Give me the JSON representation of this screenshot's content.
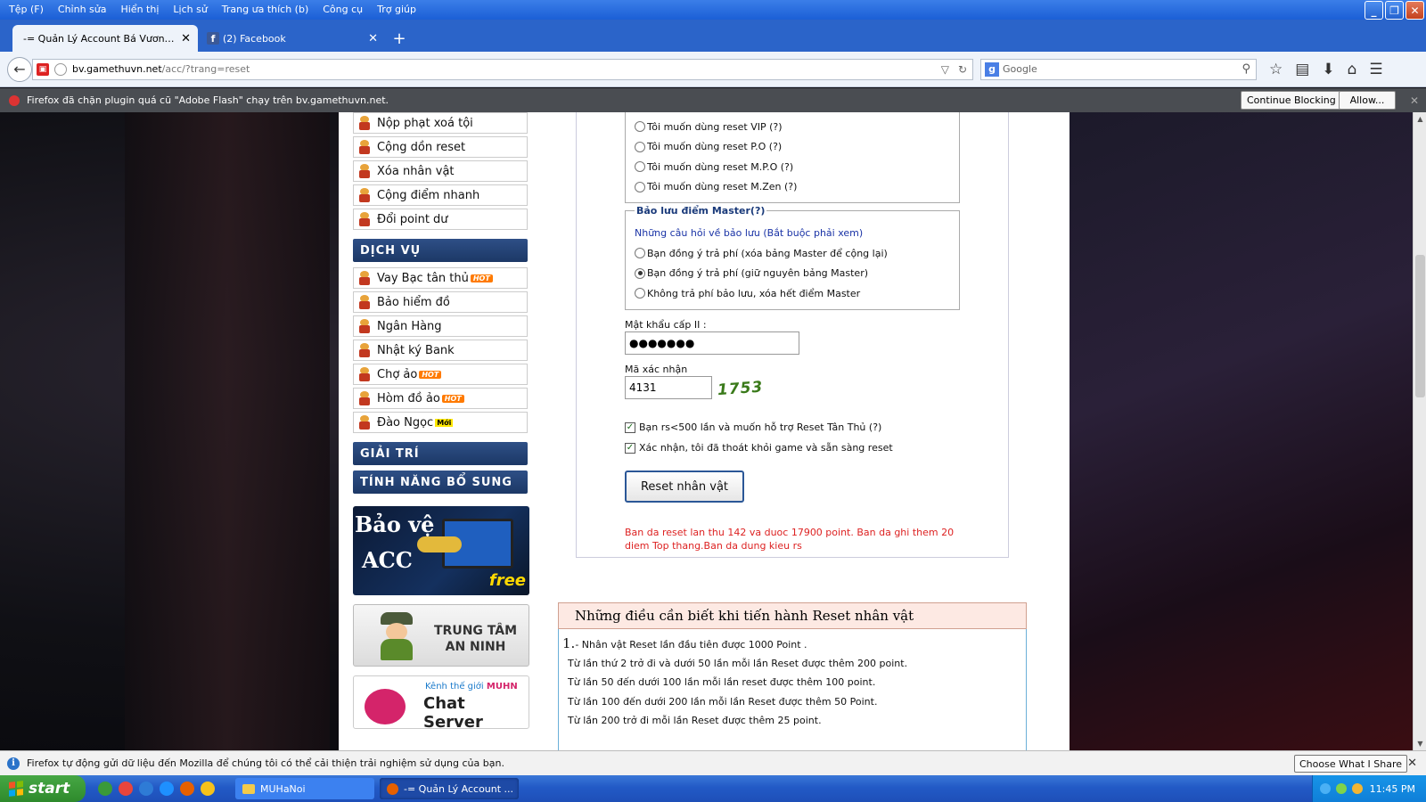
{
  "menubar": [
    "Tệp (F)",
    "Chỉnh sửa",
    "Hiển thị",
    "Lịch sử",
    "Trang ưa thích (b)",
    "Công cụ",
    "Trợ giúp"
  ],
  "tabs": [
    {
      "label": "-= Quản Lý Account Bá Vương =- ...",
      "active": true
    },
    {
      "label": "(2) Facebook",
      "active": false
    }
  ],
  "urlbar": {
    "host": "bv.gamethuvn.net",
    "path": "/acc/?trang=reset"
  },
  "searchbar": {
    "placeholder": "Google"
  },
  "plugin_bar": {
    "message": "Firefox đã chặn plugin quá cũ \"Adobe Flash\" chạy trên bv.gamethuvn.net.",
    "continue_label": "Continue Blocking",
    "allow_label": "Allow..."
  },
  "sidebar": {
    "items_top": [
      "Nộp phạt xoá tội",
      "Cộng dồn reset",
      "Xóa nhân vật",
      "Cộng điểm nhanh",
      "Đổi point dư"
    ],
    "dichvu_header": "DỊCH VỤ",
    "dichvu_items": [
      "Vay Bạc tân thủ",
      "Bảo hiểm đồ",
      "Ngân Hàng",
      "Nhật ký Bank",
      "Chợ ảo",
      "Hòm đồ ảo",
      "Đào Ngọc"
    ],
    "hot_badge": "HOT",
    "moi_badge": "Mới",
    "giaitri_header": "GIẢI TRÍ",
    "tinhnang_header": "TÍNH NĂNG BỔ SUNG",
    "banner_acc": {
      "line1": "Bảo vệ",
      "line2": "ACC",
      "tag": "free"
    },
    "banner_security": {
      "line1": "TRUNG TÂM",
      "line2": "AN NINH"
    },
    "banner_chat": {
      "kenh": "Kênh thế giới",
      "brand": "MUHN",
      "title": "Chat Server"
    }
  },
  "form": {
    "reset_options": [
      "Tôi muốn dùng reset VIP (?)",
      "Tôi muốn dùng reset P.O (?)",
      "Tôi muốn dùng reset M.P.O (?)",
      "Tôi muốn dùng reset M.Zen (?)"
    ],
    "master_legend": "Bảo lưu điểm Master(?)",
    "master_faq": "Những câu hỏi về bảo lưu (Bắt buộc phải xem)",
    "master_options": [
      {
        "label": "Bạn đồng ý trả phí (xóa bảng Master để cộng lại)",
        "checked": false
      },
      {
        "label": "Bạn đồng ý trả phí (giữ nguyên bảng Master)",
        "checked": true
      },
      {
        "label": "Không trả phí bảo lưu, xóa hết điểm Master",
        "checked": false
      }
    ],
    "password_label": "Mật khẩu cấp II :",
    "password_value": "●●●●●●●",
    "captcha_label": "Mã xác nhận",
    "captcha_input": "4131",
    "captcha_image_text": "1753",
    "check_newbie": "Bạn rs<500 lần và muốn hỗ trợ Reset Tân Thủ (?)",
    "check_confirm": "Xác nhận, tôi đã thoát khỏi game và sẵn sàng reset",
    "reset_button": "Reset nhân vật",
    "result_message": "Ban da reset lan thu 142 va duoc 17900 point. Ban da ghi them 20 diem Top thang.Ban da dung kieu rs"
  },
  "info": {
    "title": "Những điều cần biết khi tiến hành Reset nhân vật",
    "num": "1.",
    "lines": [
      "- Nhân vật Reset lần đầu tiên được 1000 Point .",
      "Từ lần thứ 2 trở đi và dưới 50 lần mỗi lần Reset được thêm 200 point.",
      "Từ lần 50 đến dưới 100 lần mỗi lần reset được thêm 100 point.",
      "Từ lần 100 đến dưới 200 lần mỗi lần Reset được thêm 50 Point.",
      "Từ lần 200 trở đi mỗi lần Reset được thêm 25 point."
    ]
  },
  "data_notice": {
    "message": "Firefox tự động gửi dữ liệu đến Mozilla để chúng tôi có thể cải thiện trải nghiệm sử dụng của bạn.",
    "button": "Choose What I Share"
  },
  "taskbar": {
    "start": "start",
    "tasks": [
      "MUHaNoi",
      "-= Quản Lý Account ..."
    ],
    "clock": "11:45 PM"
  }
}
